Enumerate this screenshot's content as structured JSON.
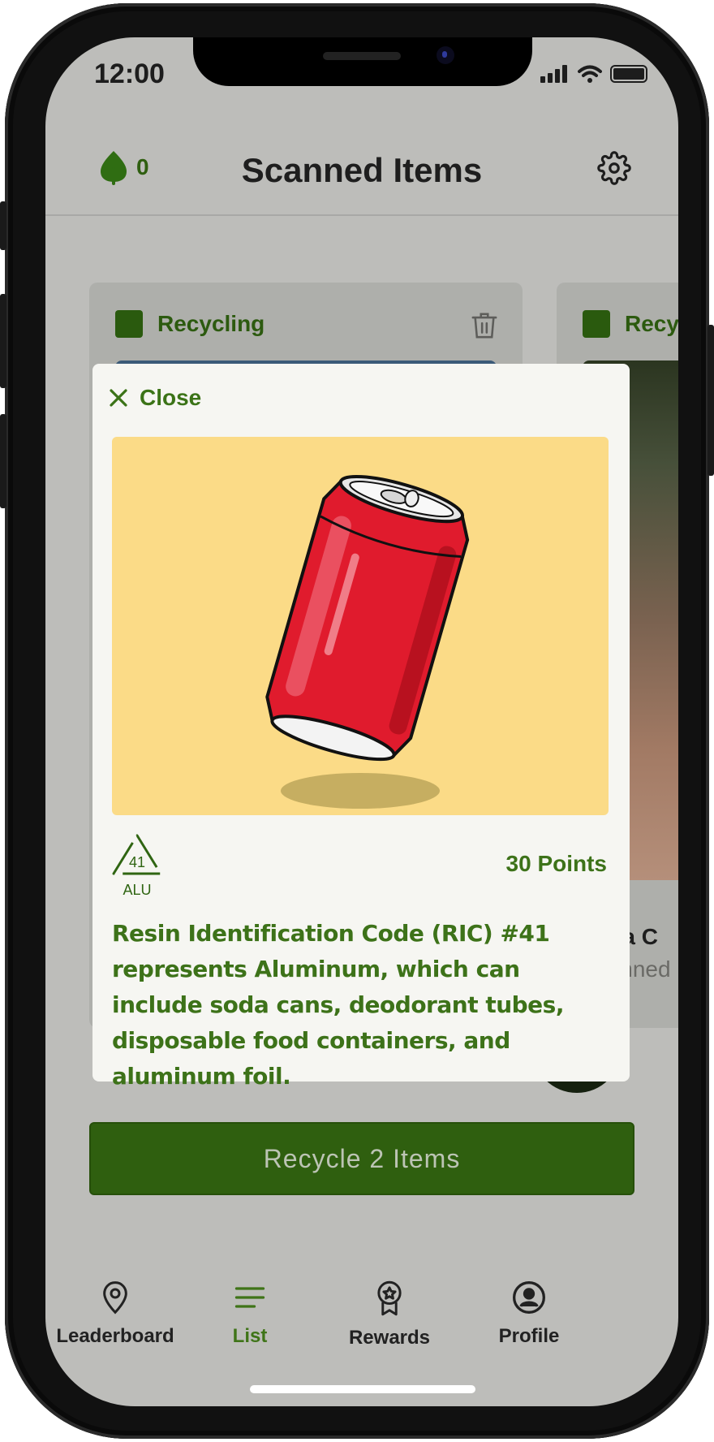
{
  "status_bar": {
    "time": "12:00"
  },
  "header": {
    "points": "0",
    "title": "Scanned Items",
    "leaf_icon": "leaf-icon",
    "settings_icon": "gear-icon"
  },
  "cards": [
    {
      "category": "Recycling"
    },
    {
      "category": "Recycling",
      "name": "Papa C",
      "subtitle": "Scanned"
    }
  ],
  "modal": {
    "close_label": "Close",
    "ric_number": "41",
    "ric_material": "ALU",
    "points": "30 Points",
    "description": "Resin Identification Code (RIC) #41 represents Aluminum, which can include soda cans, deodorant tubes, disposable food containers, and aluminum foil."
  },
  "recycle_button": {
    "label": "Recycle 2 Items"
  },
  "nav": [
    {
      "label": "Leaderboard",
      "icon": "map-pin-icon",
      "active": false
    },
    {
      "label": "List",
      "icon": "list-icon",
      "active": true
    },
    {
      "label": "Rewards",
      "icon": "award-icon",
      "active": false
    },
    {
      "label": "Profile",
      "icon": "user-icon",
      "active": false
    }
  ],
  "colors": {
    "brand_green": "#2f5f0f",
    "accent_green": "#3d7219",
    "overlay": "#bdbdba",
    "modal_bg": "#f6f6f2",
    "image_bg": "#fbdb87"
  }
}
